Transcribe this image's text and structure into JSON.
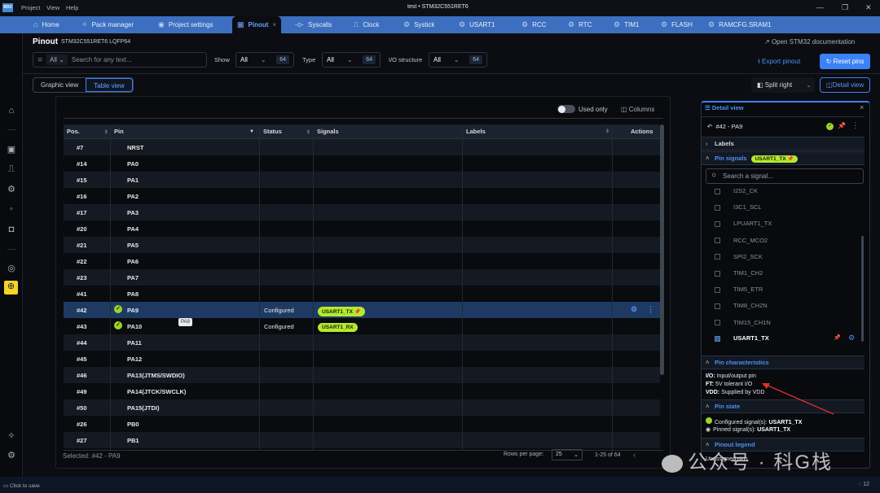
{
  "titlebar": {
    "logo": "MX2",
    "menu": [
      "Project",
      "View",
      "Help"
    ],
    "title": "test  •  STM32C551RET6"
  },
  "tabs": [
    {
      "label": "Home",
      "icon": "home-icon"
    },
    {
      "label": "Pack manager",
      "icon": "puzzle-icon"
    },
    {
      "label": "Project settings",
      "icon": "settings-icon"
    },
    {
      "label": "Pinout",
      "icon": "chip-icon",
      "active": true
    },
    {
      "label": "Syscalls",
      "icon": "syscall-icon"
    },
    {
      "label": "Clock",
      "icon": "clock-wave-icon"
    },
    {
      "label": "Systick",
      "icon": "peripheral-icon"
    },
    {
      "label": "USART1",
      "icon": "peripheral-icon"
    },
    {
      "label": "RCC",
      "icon": "peripheral-icon"
    },
    {
      "label": "RTC",
      "icon": "peripheral-icon"
    },
    {
      "label": "TIM1",
      "icon": "peripheral-icon"
    },
    {
      "label": "FLASH",
      "icon": "peripheral-icon"
    },
    {
      "label": "RAMCFG.SRAM1",
      "icon": "peripheral-icon"
    }
  ],
  "header": {
    "title": "Pinout",
    "subtitle": "STM32C551RET6 LQFP64",
    "doc_link": "Open STM32 documentation"
  },
  "filters": {
    "scope": "All",
    "search_placeholder": "Search for any text...",
    "show_label": "Show",
    "show_value": "All",
    "show_count": "64",
    "type_label": "Type",
    "type_value": "All",
    "type_count": "64",
    "io_label": "I/O structure",
    "io_value": "All",
    "io_count": "64"
  },
  "actions": {
    "export": "Export pinout",
    "reset": "Reset pins",
    "split": "Split right",
    "detail": "Detail view"
  },
  "views": {
    "graphic": "Graphic view",
    "table": "Table view"
  },
  "table": {
    "used_only": "Used only",
    "columns": "Columns",
    "headers": {
      "pos": "Pos.",
      "pin": "Pin",
      "status": "Status",
      "signals": "Signals",
      "labels": "Labels",
      "actions": "Actions"
    },
    "rows": [
      {
        "pos": "#7",
        "pin": "NRST"
      },
      {
        "pos": "#14",
        "pin": "PA0"
      },
      {
        "pos": "#15",
        "pin": "PA1"
      },
      {
        "pos": "#16",
        "pin": "PA2"
      },
      {
        "pos": "#17",
        "pin": "PA3"
      },
      {
        "pos": "#20",
        "pin": "PA4"
      },
      {
        "pos": "#21",
        "pin": "PA5"
      },
      {
        "pos": "#22",
        "pin": "PA6"
      },
      {
        "pos": "#23",
        "pin": "PA7"
      },
      {
        "pos": "#41",
        "pin": "PA8"
      },
      {
        "pos": "#42",
        "pin": "PA9",
        "status": "Configured",
        "signal": "USART1_TX 📌",
        "selected": true
      },
      {
        "pos": "#43",
        "pin": "PA10",
        "status": "Configured",
        "signal": "USART1_RX"
      },
      {
        "pos": "#44",
        "pin": "PA11"
      },
      {
        "pos": "#45",
        "pin": "PA12"
      },
      {
        "pos": "#46",
        "pin": "PA13(JTMS/SWDIO)"
      },
      {
        "pos": "#49",
        "pin": "PA14(JTCK/SWCLK)"
      },
      {
        "pos": "#50",
        "pin": "PA15(JTDI)"
      },
      {
        "pos": "#26",
        "pin": "PB0"
      },
      {
        "pos": "#27",
        "pin": "PB1"
      }
    ],
    "tooltip": "PA9",
    "selected": "Selected: #42 - PA9",
    "rows_per_page_label": "Rows per page:",
    "rows_per_page": "25",
    "range": "1-25 of 64"
  },
  "detail": {
    "title": "Detail view",
    "pin": "#42 - PA9",
    "labels": "Labels",
    "pin_signals": "Pin signals",
    "pinned_signal": "USART1_TX 📌",
    "search_placeholder": "Search a signal...",
    "signals": [
      "I2S2_CK",
      "I3C1_SCL",
      "LPUART1_TX",
      "RCC_MCO2",
      "SPI2_SCK",
      "TIM1_CH2",
      "TIM5_ETR",
      "TIM8_CH2N",
      "TIM15_CH1N"
    ],
    "checked_signal": "USART1_TX",
    "characteristics": "Pin characteristics",
    "io_k": "I/O:",
    "io_v": " Input/output pin",
    "ft_k": "FT:",
    "ft_v": " 5V tolerant I/O",
    "vdd_k": "VDD:",
    "vdd_v": " Supplied by VDD",
    "pin_state": "Pin state",
    "configured_k": "Configured signal(s): ",
    "configured_v": "USART1_TX",
    "pinned_k": "Pinned signal(s): ",
    "pinned_v": "USART1_TX",
    "legend": "Pinout legend",
    "unassigned": "Unassigned pins"
  },
  "statusbar": {
    "save": "Click to save",
    "notifications": "12"
  },
  "watermark": "公众号 · 科G栈",
  "colors": {
    "accent": "#3b82f6",
    "tabbar": "#3c6fbf",
    "signal": "#b5ea2c",
    "selected_row": "#1e3a63"
  }
}
